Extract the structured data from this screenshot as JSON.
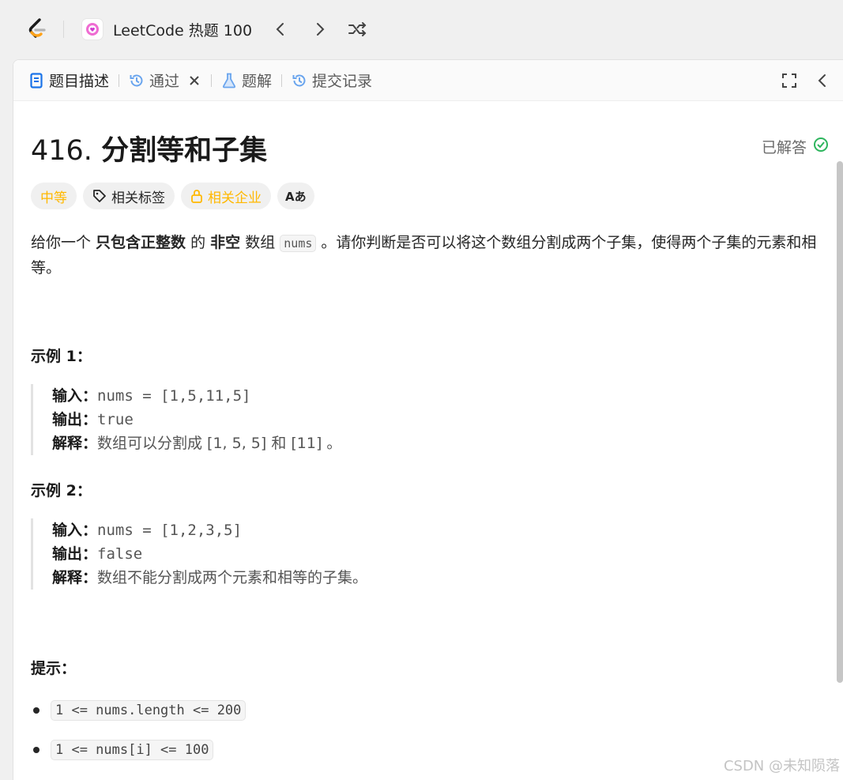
{
  "app": {
    "playlist_title": "LeetCode 热题 100"
  },
  "tabs": [
    {
      "label": "题目描述",
      "icon": "description-icon",
      "active": true
    },
    {
      "label": "通过",
      "icon": "history-icon",
      "closable": true
    },
    {
      "label": "题解",
      "icon": "flask-icon"
    },
    {
      "label": "提交记录",
      "icon": "history-icon"
    }
  ],
  "problem": {
    "number": "416.",
    "name": "分割等和子集",
    "status": "已解答",
    "tags": {
      "difficulty": "中等",
      "related_tags": "相关标签",
      "related_companies": "相关企业",
      "translate_icon": "Aあ"
    },
    "description": {
      "p1": "给你一个 ",
      "b1": "只包含正整数",
      "p2": " 的 ",
      "b2": "非空",
      "p3": " 数组 ",
      "code": "nums",
      "p4": " 。请你判断是否可以将这个数组分割成两个子集，使得两个子集的元素和相等。"
    },
    "examples": [
      {
        "heading": "示例 1：",
        "input_label": "输入：",
        "input": "nums = [1,5,11,5]",
        "output_label": "输出：",
        "output": "true",
        "explain_label": "解释：",
        "explain": "数组可以分割成 [1, 5, 5] 和 [11] 。"
      },
      {
        "heading": "示例 2：",
        "input_label": "输入：",
        "input": "nums = [1,2,3,5]",
        "output_label": "输出：",
        "output": "false",
        "explain_label": "解释：",
        "explain": "数组不能分割成两个元素和相等的子集。"
      }
    ],
    "hints_heading": "提示：",
    "constraints": [
      "1 <= nums.length <= 200",
      "1 <= nums[i] <= 100"
    ]
  },
  "watermark": "CSDN @未知陨落",
  "colors": {
    "accent_blue": "#1a73e8",
    "medium": "#ffb800",
    "solved_green": "#2db55d"
  }
}
